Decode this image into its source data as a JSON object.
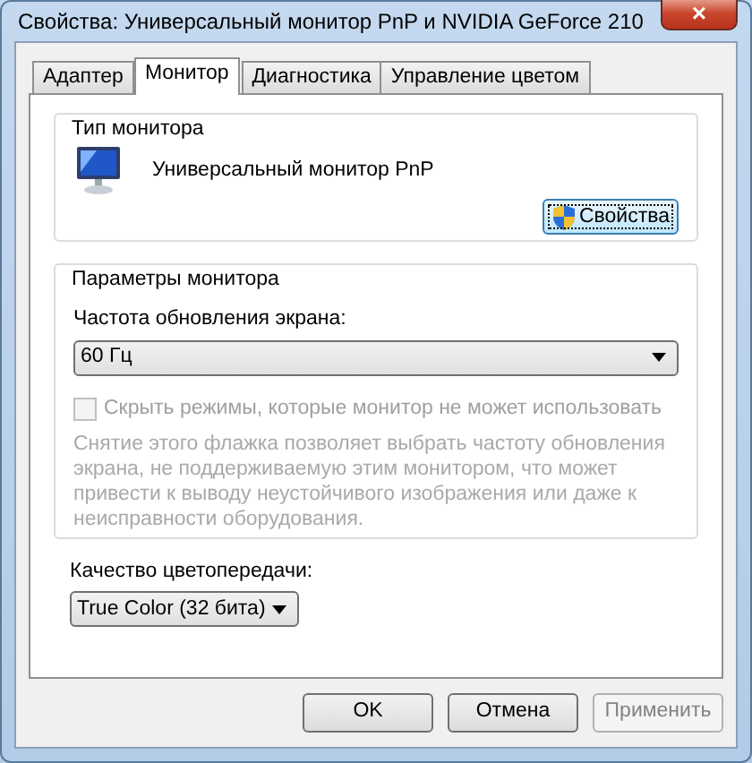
{
  "window": {
    "title": "Свойства: Универсальный монитор PnP и NVIDIA GeForce 210",
    "close": "×"
  },
  "tabs": [
    {
      "label": "Адаптер",
      "selected": false
    },
    {
      "label": "Монитор",
      "selected": true
    },
    {
      "label": "Диагностика",
      "selected": false
    },
    {
      "label": "Управление цветом",
      "selected": false
    }
  ],
  "monitor_type": {
    "legend": "Тип монитора",
    "name": "Универсальный монитор PnP",
    "properties_button": {
      "label": "Свойства",
      "focused": true
    }
  },
  "monitor_settings": {
    "legend": "Параметры монитора",
    "refresh_label": "Частота обновления экрана:",
    "refresh_value": "60 Гц",
    "hide_modes": {
      "label": "Скрыть режимы, которые монитор не может использовать",
      "checked": false,
      "disabled": true
    },
    "hint": "Снятие этого флажка позволяет выбрать частоту обновления экрана, не поддерживаемую этим монитором, что может привести к выводу неустойчивого изображения или даже к неисправности оборудования."
  },
  "color_quality": {
    "label": "Качество цветопередачи:",
    "value": "True Color (32 бита)"
  },
  "buttons": [
    {
      "label": "OK",
      "disabled": false
    },
    {
      "label": "Отмена",
      "disabled": false
    },
    {
      "label": "Применить",
      "disabled": true
    }
  ]
}
